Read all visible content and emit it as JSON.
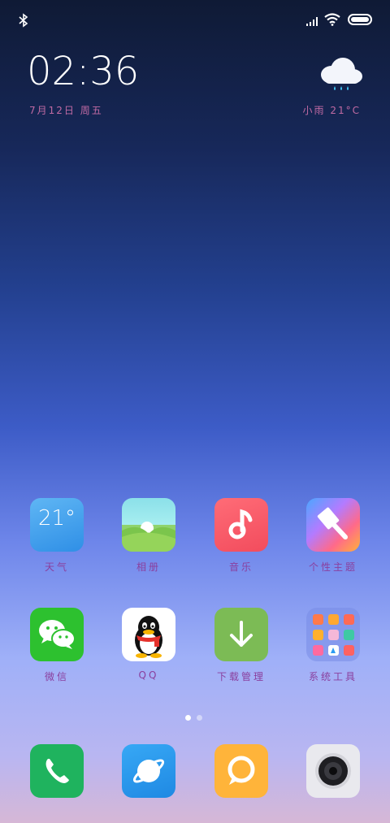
{
  "status": {
    "bluetooth_icon": "bluetooth-icon",
    "signal_icon": "signal-icon",
    "wifi_icon": "wifi-icon",
    "battery_icon": "battery-icon"
  },
  "lockscreen": {
    "time": "02:36",
    "date": "7月12日 周五",
    "weather": {
      "icon": "rain-cloud-icon",
      "text": "小雨 21°C"
    }
  },
  "apps_row1": [
    {
      "label": "天气",
      "icon": "weather-icon",
      "icon_text": "21°"
    },
    {
      "label": "相册",
      "icon": "gallery-icon"
    },
    {
      "label": "音乐",
      "icon": "music-icon"
    },
    {
      "label": "个性主题",
      "icon": "themes-icon"
    }
  ],
  "apps_row2": [
    {
      "label": "微信",
      "icon": "wechat-icon"
    },
    {
      "label": "QQ",
      "icon": "qq-icon"
    },
    {
      "label": "下载管理",
      "icon": "download-icon"
    },
    {
      "label": "系统工具",
      "icon": "folder-icon"
    }
  ],
  "page_indicator": {
    "pages": 2,
    "current": 1
  },
  "dock": [
    {
      "icon": "phone-icon"
    },
    {
      "icon": "browser-icon"
    },
    {
      "icon": "messages-icon"
    },
    {
      "icon": "camera-icon"
    }
  ],
  "colors": {
    "label_color": "#8a3f9e",
    "date_color": "#c06aa3"
  }
}
